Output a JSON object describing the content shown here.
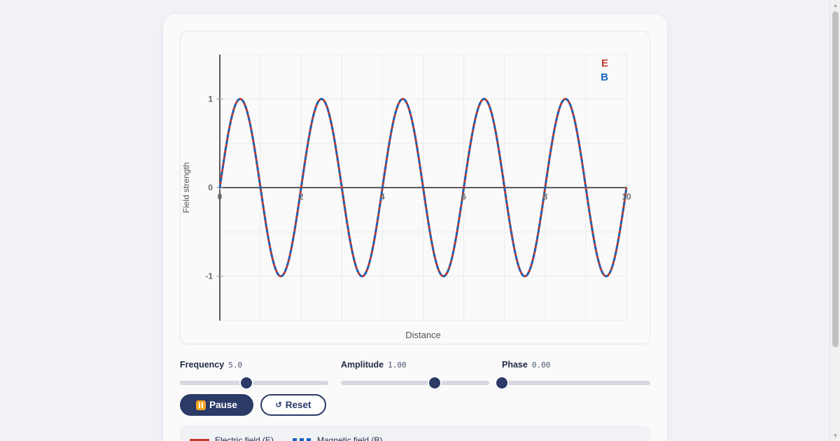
{
  "chart_data": {
    "type": "line",
    "xlabel": "Distance",
    "ylabel": "Field strength",
    "xlim": [
      0,
      10
    ],
    "ylim": [
      -1.5,
      1.5
    ],
    "x_ticks": [
      "0",
      "2",
      "4",
      "6",
      "8",
      "10"
    ],
    "y_ticks": [
      "1",
      "0",
      "-1"
    ],
    "grid": true,
    "legend_position": "top-right",
    "series": [
      {
        "name": "E",
        "color": "#c0392b",
        "style": "solid",
        "amplitude": 1.0,
        "wavelength": 2.0,
        "phase": 0.0,
        "x_start": 0,
        "x_end": 10
      },
      {
        "name": "B",
        "color": "#1565c0",
        "style": "dashed",
        "amplitude": 1.0,
        "wavelength": 2.0,
        "phase": 0.0,
        "x_start": 0,
        "x_end": 10
      }
    ]
  },
  "controls": {
    "frequency": {
      "label": "Frequency",
      "value": "5.0",
      "fraction": 0.45
    },
    "amplitude": {
      "label": "Amplitude",
      "value": "1.00",
      "fraction": 0.63
    },
    "phase": {
      "label": "Phase",
      "value": "0.00",
      "fraction": 0.0
    }
  },
  "buttons": {
    "pause_label": "Pause",
    "reset_label": "Reset",
    "reset_glyph": "↺"
  },
  "legend": {
    "electric_label": "Electric field (E)",
    "magnetic_label": "Magnetic field (B)"
  },
  "colors": {
    "accent": "#2b3a67",
    "electric": "#c0392b",
    "magnetic": "#1565c0"
  }
}
